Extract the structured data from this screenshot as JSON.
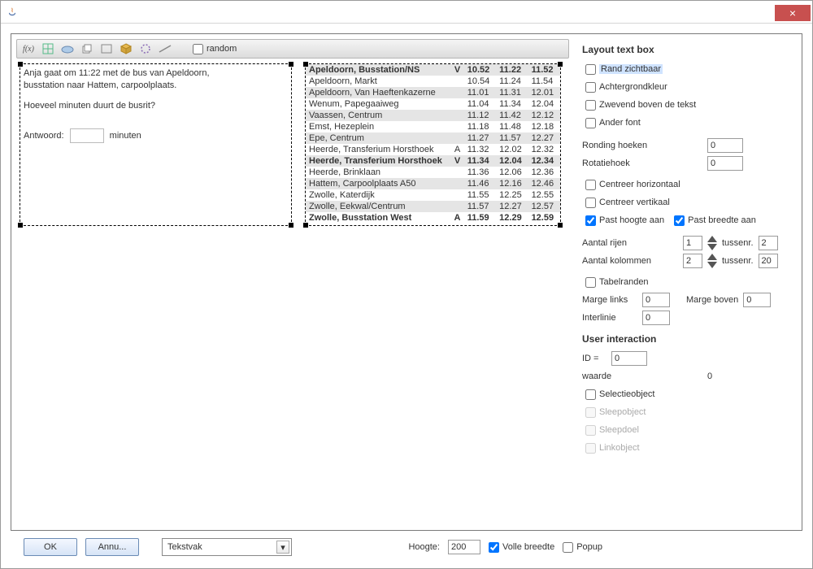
{
  "title": "",
  "toolbar": {
    "random_label": "random"
  },
  "textbox1": {
    "line1": "Anja gaat om 11:22 met de bus van Apeldoorn,",
    "line2": "busstation naar Hattem, carpoolplaats.",
    "question": "Hoeveel minuten duurt de busrit?",
    "answer_label": "Antwoord:",
    "answer_unit": "minuten",
    "answer_value": ""
  },
  "schedule": [
    {
      "stop": "Apeldoorn, Busstation/NS",
      "flag": "V",
      "t1": "10.52",
      "t2": "11.22",
      "t3": "11.52",
      "bold": true,
      "zebra": true
    },
    {
      "stop": "Apeldoorn, Markt",
      "flag": "",
      "t1": "10.54",
      "t2": "11.24",
      "t3": "11.54",
      "bold": false,
      "zebra": false
    },
    {
      "stop": "Apeldoorn, Van Haeftenkazerne",
      "flag": "",
      "t1": "11.01",
      "t2": "11.31",
      "t3": "12.01",
      "bold": false,
      "zebra": true
    },
    {
      "stop": "Wenum, Papegaaiweg",
      "flag": "",
      "t1": "11.04",
      "t2": "11.34",
      "t3": "12.04",
      "bold": false,
      "zebra": false
    },
    {
      "stop": "Vaassen, Centrum",
      "flag": "",
      "t1": "11.12",
      "t2": "11.42",
      "t3": "12.12",
      "bold": false,
      "zebra": true
    },
    {
      "stop": "Emst, Hezeplein",
      "flag": "",
      "t1": "11.18",
      "t2": "11.48",
      "t3": "12.18",
      "bold": false,
      "zebra": false
    },
    {
      "stop": "Epe, Centrum",
      "flag": "",
      "t1": "11.27",
      "t2": "11.57",
      "t3": "12.27",
      "bold": false,
      "zebra": true
    },
    {
      "stop": "Heerde, Transferium Horsthoek",
      "flag": "A",
      "t1": "11.32",
      "t2": "12.02",
      "t3": "12.32",
      "bold": false,
      "zebra": false
    },
    {
      "stop": "Heerde, Transferium Horsthoek",
      "flag": "V",
      "t1": "11.34",
      "t2": "12.04",
      "t3": "12.34",
      "bold": true,
      "zebra": true
    },
    {
      "stop": "Heerde, Brinklaan",
      "flag": "",
      "t1": "11.36",
      "t2": "12.06",
      "t3": "12.36",
      "bold": false,
      "zebra": false
    },
    {
      "stop": "Hattem, Carpoolplaats A50",
      "flag": "",
      "t1": "11.46",
      "t2": "12.16",
      "t3": "12.46",
      "bold": false,
      "zebra": true
    },
    {
      "stop": "Zwolle, Katerdijk",
      "flag": "",
      "t1": "11.55",
      "t2": "12.25",
      "t3": "12.55",
      "bold": false,
      "zebra": false
    },
    {
      "stop": "Zwolle, Eekwal/Centrum",
      "flag": "",
      "t1": "11.57",
      "t2": "12.27",
      "t3": "12.57",
      "bold": false,
      "zebra": true
    },
    {
      "stop": "Zwolle, Busstation West",
      "flag": "A",
      "t1": "11.59",
      "t2": "12.29",
      "t3": "12.59",
      "bold": true,
      "zebra": false
    }
  ],
  "side": {
    "layout_title": "Layout text box",
    "rand_zichtbaar": "Rand zichtbaar",
    "achtergrondkleur": "Achtergrondkleur",
    "zwevend": "Zwevend boven de tekst",
    "ander_font": "Ander font",
    "ronding_label": "Ronding hoeken",
    "ronding_value": "0",
    "rotatie_label": "Rotatiehoek",
    "rotatie_value": "0",
    "centreer_h": "Centreer horizontaal",
    "centreer_v": "Centreer vertikaal",
    "past_hoogte": "Past hoogte aan",
    "past_breedte": "Past breedte aan",
    "aantal_rijen_label": "Aantal rijen",
    "aantal_rijen_value": "1",
    "tussenr1_label": "tussenr.",
    "tussenr1_value": "2",
    "aantal_kol_label": "Aantal kolommen",
    "aantal_kol_value": "2",
    "tussenr2_label": "tussenr.",
    "tussenr2_value": "20",
    "tabelranden": "Tabelranden",
    "marge_links_label": "Marge links",
    "marge_links_value": "0",
    "marge_boven_label": "Marge boven",
    "marge_boven_value": "0",
    "interlinie_label": "Interlinie",
    "interlinie_value": "0",
    "user_interaction_title": "User interaction",
    "id_label": "ID =",
    "id_value": "0",
    "waarde_label": "waarde",
    "waarde_value": "0",
    "selectieobject": "Selectieobject",
    "sleepobject": "Sleepobject",
    "sleepdoel": "Sleepdoel",
    "linkobject": "Linkobject"
  },
  "footer": {
    "ok": "OK",
    "annuleer": "Annu...",
    "combo_value": "Tekstvak",
    "hoogte_label": "Hoogte:",
    "hoogte_value": "200",
    "volle_breedte": "Volle breedte",
    "popup": "Popup"
  }
}
